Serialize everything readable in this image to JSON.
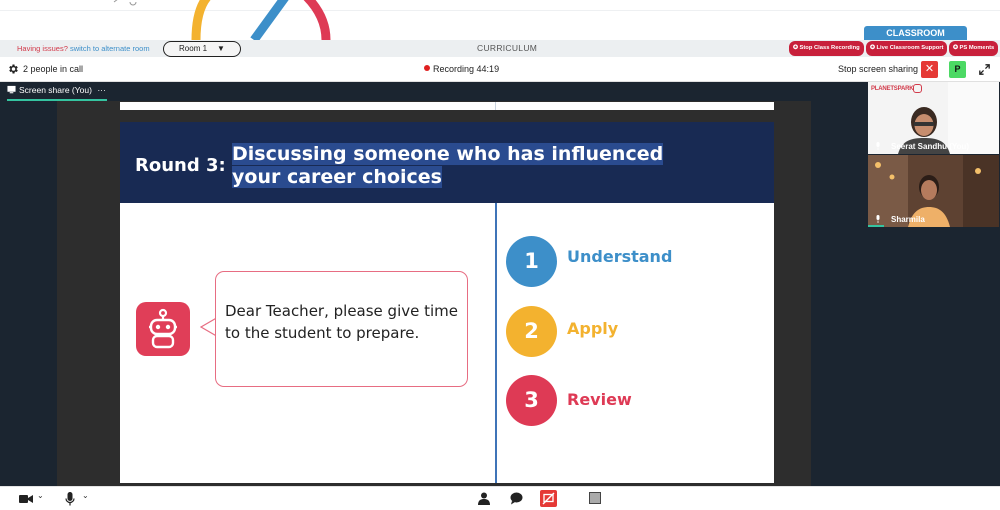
{
  "top_bar": {
    "tab_label": "CLASSROOM",
    "issues_text": "Having issues?",
    "issues_link": "switch to alternate room",
    "room_value": "Room 1",
    "section_title": "CURRICULUM",
    "actions": {
      "stop_recording": "Stop Class Recording",
      "live_support": "Live Classroom Support",
      "ps_moments": "PS Moments"
    }
  },
  "call_bar": {
    "people_count": "2 people in call",
    "recording_label": "Recording",
    "recording_time": "44:19",
    "stop_share_label": "Stop screen sharing",
    "p_label": "P"
  },
  "share_tab": {
    "label": "Screen share (You)",
    "more": "···"
  },
  "slide": {
    "round_label": "Round 3:",
    "question": "Discussing someone who has influenced your career choices",
    "bubble_text": "Dear Teacher, please give time to the student to prepare.",
    "steps": [
      {
        "number": "1",
        "label": "Understand",
        "color": "#3d8fc9"
      },
      {
        "number": "2",
        "label": "Apply",
        "color": "#f3b22f"
      },
      {
        "number": "3",
        "label": "Review",
        "color": "#de3a55"
      }
    ]
  },
  "participants": [
    {
      "name": "Seerat Sandhu (You)",
      "logo_text": "PLANETSPARK"
    },
    {
      "name": "Sharmila"
    }
  ],
  "colors": {
    "accent_blue": "#3d8fc9",
    "danger_red": "#c8203b",
    "dark_bg": "#1b2530",
    "slide_header": "#182a53",
    "highlight_green": "#35c4a0"
  }
}
